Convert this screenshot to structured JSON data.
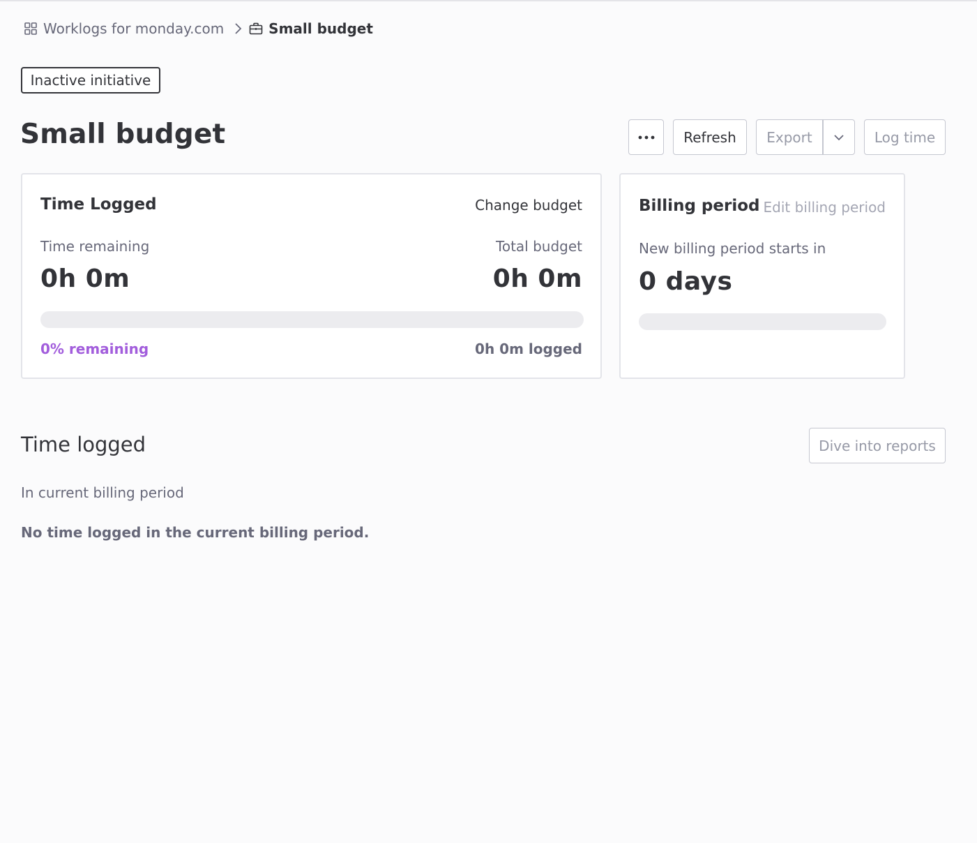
{
  "breadcrumb": {
    "root": "Worklogs for monday.com",
    "current": "Small budget"
  },
  "status_badge": "Inactive initiative",
  "page_title": "Small budget",
  "actions": {
    "more_label": "•••",
    "refresh": "Refresh",
    "export": "Export",
    "log_time": "Log time"
  },
  "time_card": {
    "title": "Time Logged",
    "change_budget": "Change budget",
    "remaining_label": "Time remaining",
    "remaining_value": "0h 0m",
    "total_label": "Total budget",
    "total_value": "0h 0m",
    "progress_fraction": 0,
    "remaining_pct": "0% remaining",
    "logged": "0h 0m logged"
  },
  "billing_card": {
    "title": "Billing period",
    "edit": "Edit billing period",
    "starts_label": "New billing period starts in",
    "starts_value": "0 days",
    "progress_fraction": 0
  },
  "time_logged": {
    "title": "Time logged",
    "reports_button": "Dive into reports",
    "subtitle": "In current billing period",
    "empty_message": "No time logged in the current billing period."
  },
  "colors": {
    "accent_purple": "#a25ddc",
    "text_primary": "#323338",
    "text_secondary": "#676879",
    "border": "#c5c7d0"
  },
  "icons": {
    "breadcrumb_root": "grid-icon",
    "breadcrumb_separator": "chevron-right-icon",
    "breadcrumb_current": "briefcase-icon",
    "export_caret": "chevron-down-icon"
  }
}
